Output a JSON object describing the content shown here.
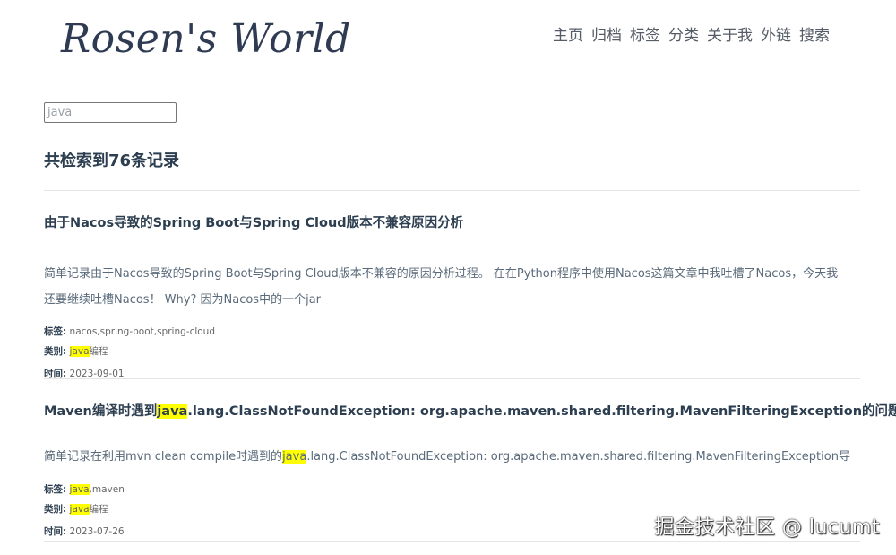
{
  "header": {
    "site_title": "Rosen's World",
    "nav": [
      "主页",
      "归档",
      "标签",
      "分类",
      "关于我",
      "外链",
      "搜索"
    ]
  },
  "search": {
    "value": "java",
    "result_count": "共检索到76条记录"
  },
  "labels": {
    "tags": "标签:",
    "category": "类别:",
    "date": "时间:"
  },
  "posts": [
    {
      "title": "由于Nacos导致的Spring Boot与Spring Cloud版本不兼容原因分析",
      "summary_line1": "简单记录由于Nacos导致的Spring Boot与Spring Cloud版本不兼容的原因分析过程。 在在Python程序中使用Nacos这篇文章中我吐槽了Nacos，今天我",
      "summary_line2": "还要继续吐槽Nacos！ Why? 因为Nacos中的一个jar",
      "tags": "nacos,spring-boot,spring-cloud",
      "category_hl": "java",
      "category_rest": "编程",
      "date": "2023-09-01"
    },
    {
      "title_before": "Maven编译时遇到",
      "title_hl": "java",
      "title_after": ".lang.ClassNotFoundException: org.apache.maven.shared.filtering.MavenFilteringException的问题解决",
      "summary_before": "简单记录在利用mvn clean compile时遇到的",
      "summary_hl": "java",
      "summary_after": ".lang.ClassNotFoundException: org.apache.maven.shared.filtering.MavenFilteringException导",
      "tags_hl": "java",
      "tags_rest": ",maven",
      "category_hl": "java",
      "category_rest": "编程",
      "date": "2023-07-26"
    }
  ],
  "watermark": "掘金技术社区 @ lucumt"
}
